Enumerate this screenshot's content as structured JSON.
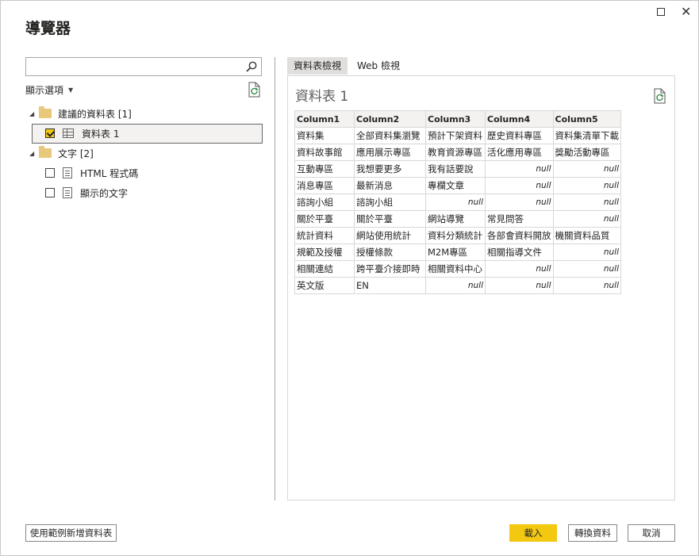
{
  "window": {
    "title": "導覽器",
    "maximize_icon": "maximize-icon",
    "close_icon": "close-icon",
    "close_glyph": "✕"
  },
  "left": {
    "search": {
      "value": "",
      "placeholder": ""
    },
    "display_options": {
      "label": "顯示選項",
      "caret": "▼"
    },
    "tree": [
      {
        "label": "建議的資料表 [1]",
        "type": "folder",
        "expanded": true
      },
      {
        "label": "資料表 1",
        "type": "table",
        "checked": true,
        "selected": true
      },
      {
        "label": "文字 [2]",
        "type": "folder",
        "expanded": true
      },
      {
        "label": "HTML 程式碼",
        "type": "document",
        "checked": false
      },
      {
        "label": "顯示的文字",
        "type": "document",
        "checked": false
      }
    ],
    "expand_glyph": "◢"
  },
  "right": {
    "tabs": [
      {
        "label": "資料表檢視",
        "active": true
      },
      {
        "label": "Web 檢視",
        "active": false
      }
    ],
    "preview_title": "資料表 1",
    "columns": [
      "Column1",
      "Column2",
      "Column3",
      "Column4",
      "Column5"
    ],
    "rows": [
      [
        "資料集",
        "全部資料集瀏覽",
        "預計下架資料",
        "歷史資料專區",
        "資料集清單下載"
      ],
      [
        "資料故事館",
        "應用展示專區",
        "教育資源專區",
        "活化應用專區",
        "獎勵活動專區"
      ],
      [
        "互動專區",
        "我想要更多",
        "我有話要說",
        "null",
        "null"
      ],
      [
        "消息專區",
        "最新消息",
        "專欄文章",
        "null",
        "null"
      ],
      [
        "諮詢小組",
        "諮詢小組",
        "null",
        "null",
        "null"
      ],
      [
        "關於平臺",
        "關於平臺",
        "網站導覽",
        "常見問答",
        "null"
      ],
      [
        "統計資料",
        "網站使用統計",
        "資料分類統計",
        "各部會資料開放",
        "機關資料品質"
      ],
      [
        "規範及授權",
        "授權條款",
        "M2M專區",
        "相關指導文件",
        "null"
      ],
      [
        "相關連結",
        "跨平臺介接即時",
        "相關資料中心",
        "null",
        "null"
      ],
      [
        "英文版",
        "EN",
        "null",
        "null",
        "null"
      ]
    ]
  },
  "footer": {
    "add_table_using_examples": "使用範例新增資料表",
    "load": "載入",
    "transform_data": "轉換資料",
    "cancel": "取消"
  },
  "colors": {
    "accent": "#f2c811",
    "folder": "#e8c87b",
    "selected_row_bg": "#f3f2f1"
  }
}
